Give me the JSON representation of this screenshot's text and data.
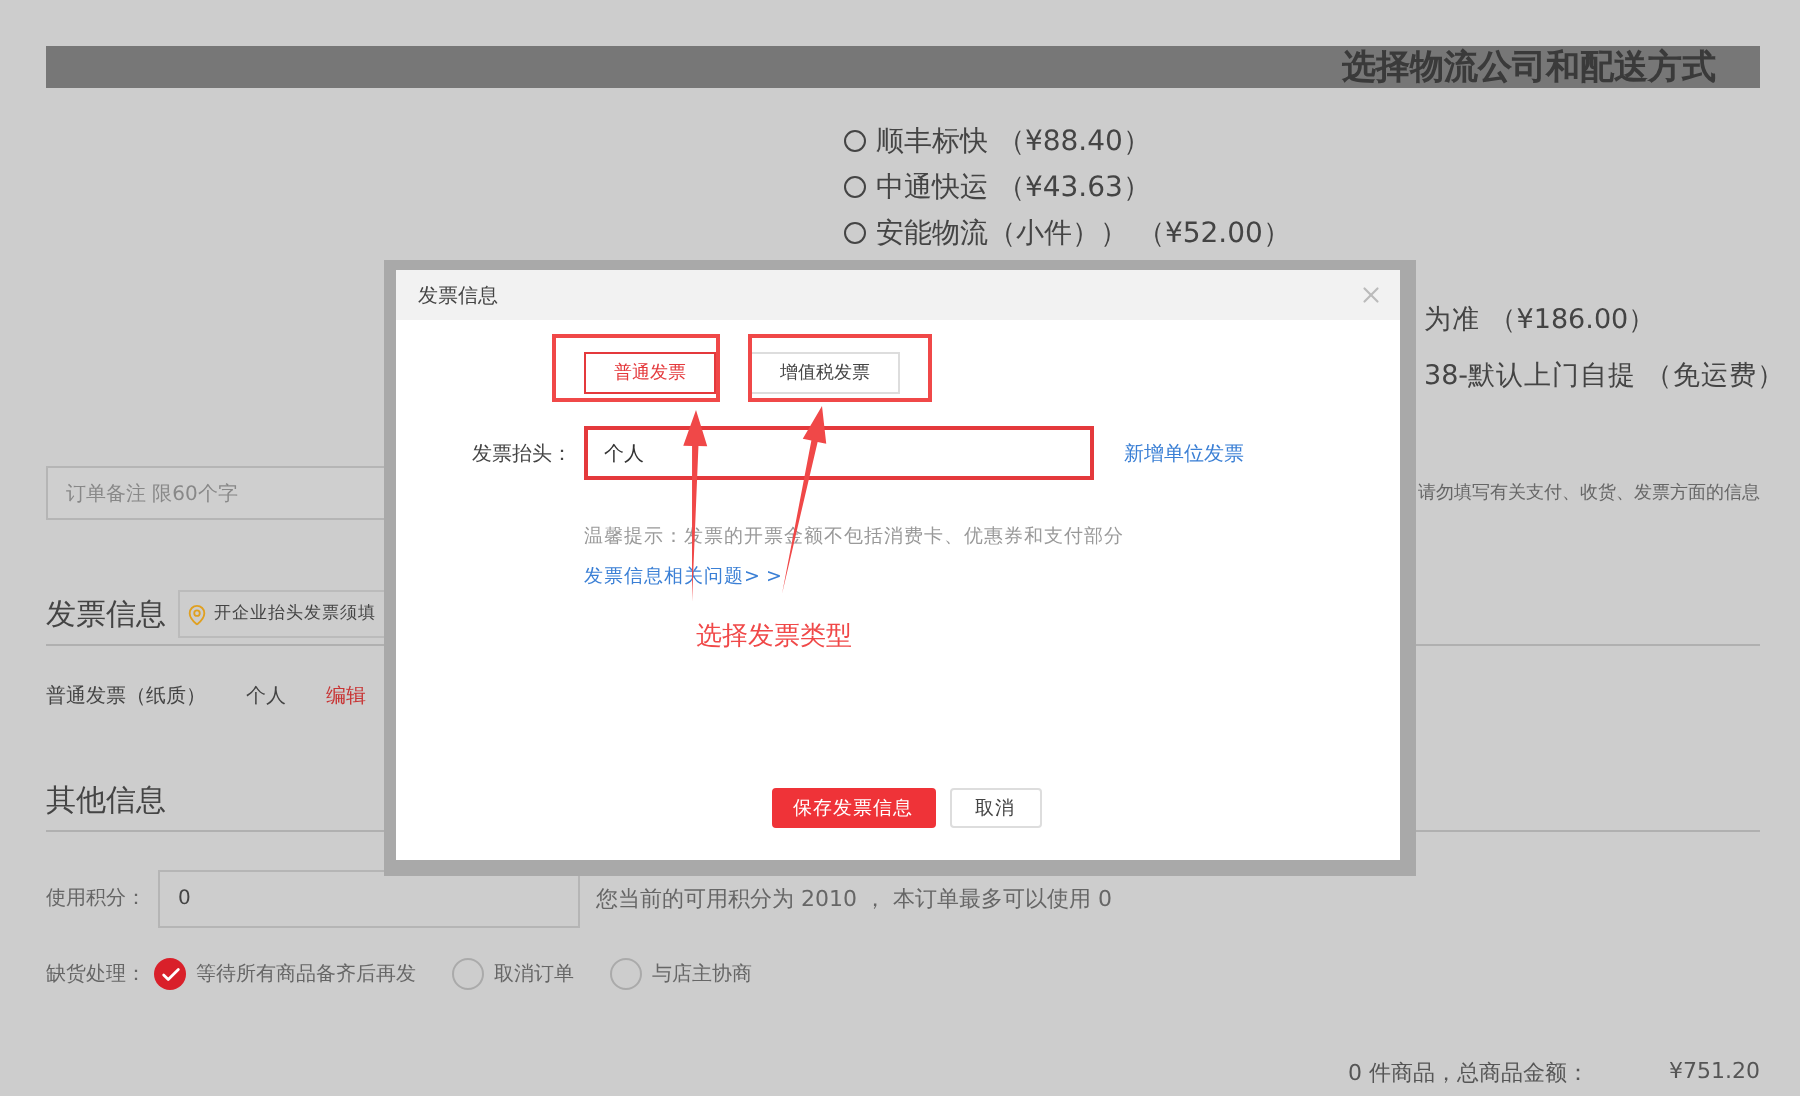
{
  "page_header": {
    "title": "选择物流公司和配送方式"
  },
  "shipping_options": [
    {
      "label": "顺丰标快 （¥88.40）",
      "selected": false
    },
    {
      "label": "中通快运 （¥43.63）",
      "selected": false
    },
    {
      "label": "安能物流（小件）） （¥52.00）",
      "selected": false
    }
  ],
  "delivery_lines": [
    "为准 （¥186.00）",
    "38-默认上门自提 （免运费）"
  ],
  "order_note": {
    "placeholder": "订单备注 限60个字",
    "hint": "请勿填写有关支付、收货、发票方面的信息"
  },
  "invoice_section": {
    "title": "发票信息",
    "tip": "开企业抬头发票须填",
    "type": "普通发票（纸质）",
    "header": "个人",
    "edit": "编辑"
  },
  "other_section": {
    "title": "其他信息",
    "points_label": "使用积分：",
    "points_value": "0",
    "points_hint": "您当前的可用积分为 2010 ， 本订单最多可以使用 0",
    "stockout_label": "缺货处理：",
    "stockout_options": [
      {
        "label": "等待所有商品备齐后再发",
        "selected": true
      },
      {
        "label": "取消订单",
        "selected": false
      },
      {
        "label": "与店主协商",
        "selected": false
      }
    ]
  },
  "summary": {
    "count": "0 件商品，总商品金额：",
    "total": "¥751.20"
  },
  "dialog": {
    "title": "发票信息",
    "tabs": [
      {
        "label": "普通发票",
        "selected": true
      },
      {
        "label": "增值税发票",
        "selected": false
      }
    ],
    "header_label": "发票抬头：",
    "header_value": "个人",
    "add_link": "新增单位发票",
    "hint": "温馨提示：发票的开票金额不包括消费卡、优惠券和支付部分",
    "faq_link": "发票信息相关问题> >",
    "buttons": [
      {
        "label": "保存发票信息",
        "kind": "primary"
      },
      {
        "label": "取消",
        "kind": "secondary"
      }
    ]
  },
  "annotation": {
    "text": "选择发票类型"
  }
}
